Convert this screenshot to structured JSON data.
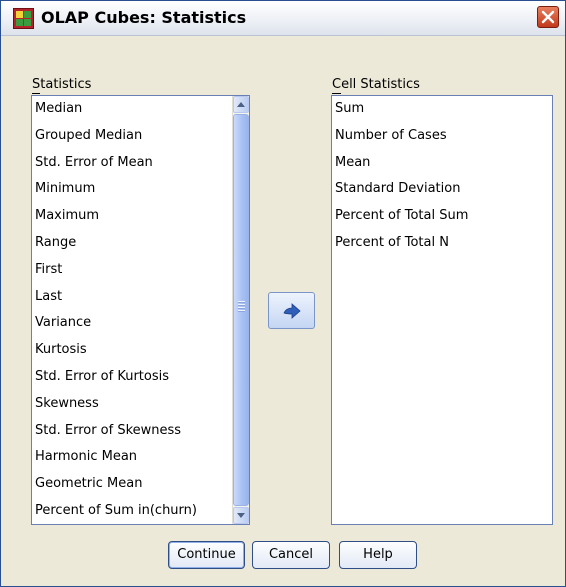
{
  "window": {
    "title": "OLAP Cubes: Statistics",
    "icons": {
      "app": "spss-table-icon",
      "close": "close-x-icon"
    }
  },
  "statistics": {
    "label": "Statistics",
    "items": [
      "Median",
      "Grouped Median",
      "Std. Error of Mean",
      "Minimum",
      "Maximum",
      "Range",
      "First",
      "Last",
      "Variance",
      "Kurtosis",
      "Std. Error of Kurtosis",
      "Skewness",
      "Std. Error of Skewness",
      "Harmonic Mean",
      "Geometric Mean",
      "Percent of Sum in(churn)"
    ]
  },
  "cell_statistics": {
    "label": "Cell Statistics",
    "items": [
      "Sum",
      "Number of Cases",
      "Mean",
      "Standard Deviation",
      "Percent of Total Sum",
      "Percent of Total N"
    ]
  },
  "move_button": {
    "icon": "arrow-right-icon"
  },
  "buttons": {
    "continue": "Continue",
    "cancel": "Cancel",
    "help": "Help"
  },
  "colors": {
    "dialog_background": "#ece9d8",
    "list_border": "#6a80b5",
    "close_button": "#c2391c"
  }
}
